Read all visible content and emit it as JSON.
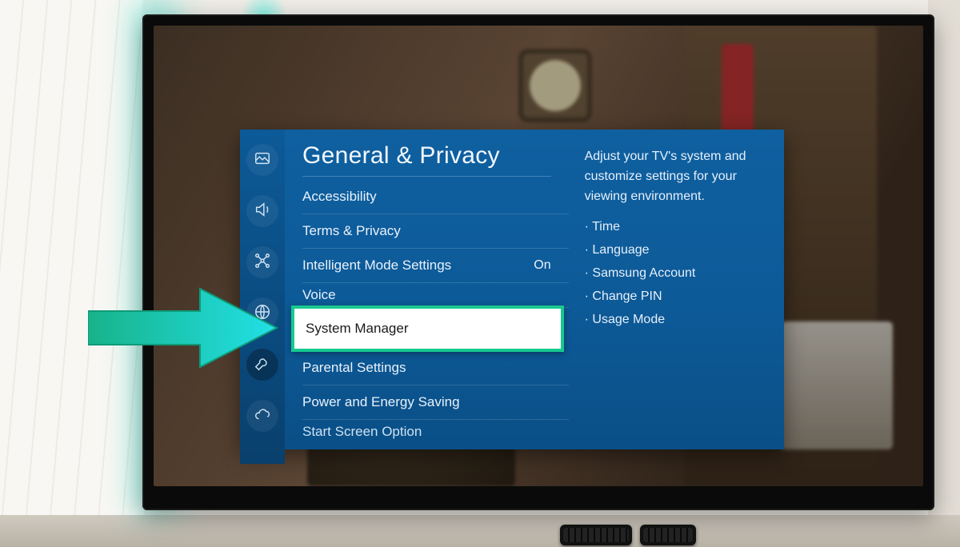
{
  "settings": {
    "title": "General & Privacy",
    "rail": [
      {
        "name": "picture-icon"
      },
      {
        "name": "sound-icon"
      },
      {
        "name": "connection-icon"
      },
      {
        "name": "broadcast-icon"
      },
      {
        "name": "wrench-icon"
      },
      {
        "name": "cloud-icon"
      }
    ],
    "items": [
      {
        "label": "Accessibility",
        "value": ""
      },
      {
        "label": "Terms & Privacy",
        "value": ""
      },
      {
        "label": "Intelligent Mode Settings",
        "value": "On"
      },
      {
        "label": "Voice",
        "value": ""
      },
      {
        "label": "System Manager",
        "value": "",
        "selected": true
      },
      {
        "label": "Parental Settings",
        "value": ""
      },
      {
        "label": "Power and Energy Saving",
        "value": ""
      },
      {
        "label": "Start Screen Option",
        "value": "",
        "cut": true
      }
    ],
    "description": {
      "text": "Adjust your TV's system and customize settings for your viewing environment.",
      "bullets": [
        "Time",
        "Language",
        "Samsung Account",
        "Change PIN",
        "Usage Mode"
      ]
    }
  },
  "colors": {
    "overlay_top": "#0f60a0",
    "overlay_bottom": "#0a4f87",
    "highlight_border": "#18c98f",
    "highlight_bg": "#ffffff",
    "arrow_fill_start": "#17b38a",
    "arrow_fill_end": "#20d9e0"
  }
}
